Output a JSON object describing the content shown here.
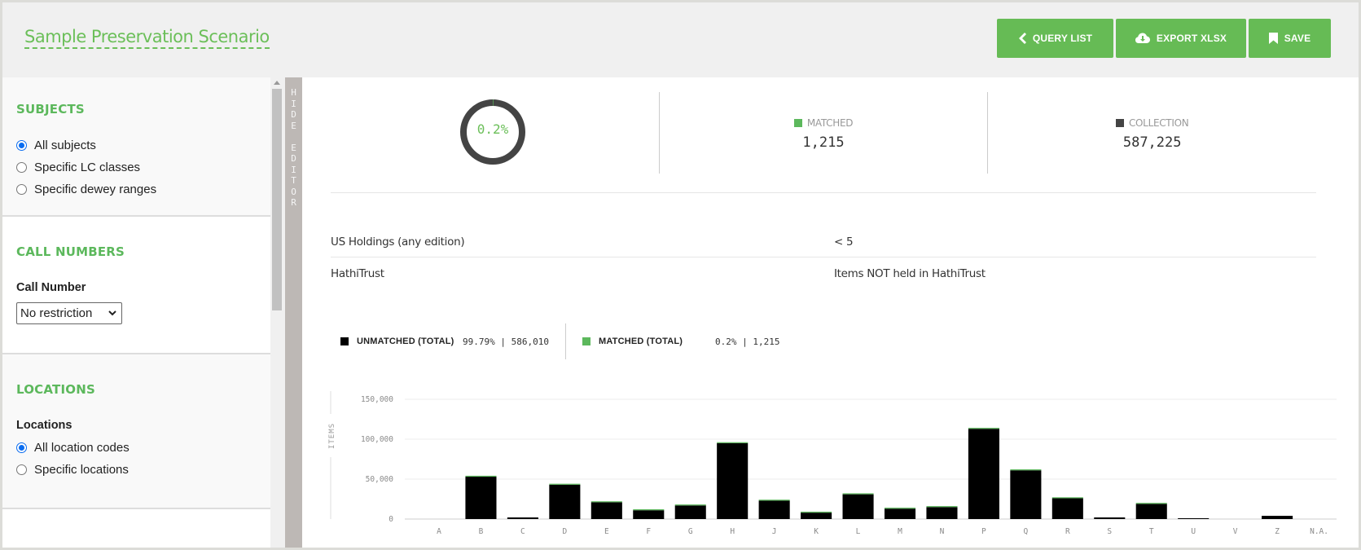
{
  "header": {
    "title": "Sample Preservation Scenario",
    "buttons": [
      {
        "label": "QUERY LIST",
        "icon": "chevron-left-icon"
      },
      {
        "label": "EXPORT XLSX",
        "icon": "cloud-download-icon"
      },
      {
        "label": "SAVE",
        "icon": "bookmark-icon"
      }
    ]
  },
  "sidebar": {
    "subjects": {
      "title": "SUBJECTS",
      "options": [
        {
          "label": "All subjects",
          "selected": true
        },
        {
          "label": "Specific LC classes",
          "selected": false
        },
        {
          "label": "Specific dewey ranges",
          "selected": false
        }
      ]
    },
    "call_numbers": {
      "title": "CALL NUMBERS",
      "field_label": "Call Number",
      "selected": "No restriction"
    },
    "locations": {
      "title": "LOCATIONS",
      "field_label": "Locations",
      "options": [
        {
          "label": "All location codes",
          "selected": true
        },
        {
          "label": "Specific locations",
          "selected": false
        }
      ]
    },
    "hide_editor_label": "H\nI\nD\nE\n\nE\nD\nI\nT\nO\nR"
  },
  "summary": {
    "percent_label": "0.2%",
    "percent_value": 0.2,
    "matched_label": "MATCHED",
    "matched_value": "1,215",
    "collection_label": "COLLECTION",
    "collection_value": "587,225"
  },
  "criteria": [
    {
      "key": "US Holdings (any edition)",
      "value": "< 5"
    },
    {
      "key": "HathiTrust",
      "value": "Items NOT held in HathiTrust"
    }
  ],
  "legend": [
    {
      "name": "UNMATCHED (TOTAL)",
      "value": "99.79% | 586,010",
      "color": "#000000"
    },
    {
      "name": "MATCHED (TOTAL)",
      "value": "0.2% | 1,215",
      "color": "#5cb85c"
    }
  ],
  "colors": {
    "accent": "#66bb55",
    "unmatched": "#000000",
    "matched": "#5cb85c",
    "collection": "#444444"
  },
  "chart_data": {
    "type": "bar",
    "stacked": true,
    "title": "",
    "xlabel": "",
    "ylabel": "ITEMS",
    "ylim": [
      0,
      150000
    ],
    "yticks": [
      0,
      50000,
      100000,
      150000
    ],
    "ytick_labels": [
      "0",
      "50,000",
      "100,000",
      "150,000"
    ],
    "grid": true,
    "categories": [
      "A",
      "B",
      "C",
      "D",
      "E",
      "F",
      "G",
      "H",
      "J",
      "K",
      "L",
      "M",
      "N",
      "P",
      "Q",
      "R",
      "S",
      "T",
      "U",
      "V",
      "Z",
      "N.A."
    ],
    "series": [
      {
        "name": "Unmatched",
        "color": "#000000",
        "values": [
          0,
          53000,
          2000,
          43000,
          21000,
          11000,
          17000,
          95000,
          23000,
          8000,
          31000,
          13000,
          15000,
          113000,
          61000,
          26000,
          2000,
          19000,
          1000,
          0,
          4000,
          0
        ]
      },
      {
        "name": "Matched",
        "color": "#5cb85c",
        "values": [
          0,
          100,
          0,
          100,
          50,
          50,
          50,
          200,
          50,
          20,
          500,
          30,
          30,
          200,
          100,
          50,
          0,
          50,
          0,
          0,
          0,
          0
        ]
      }
    ]
  }
}
